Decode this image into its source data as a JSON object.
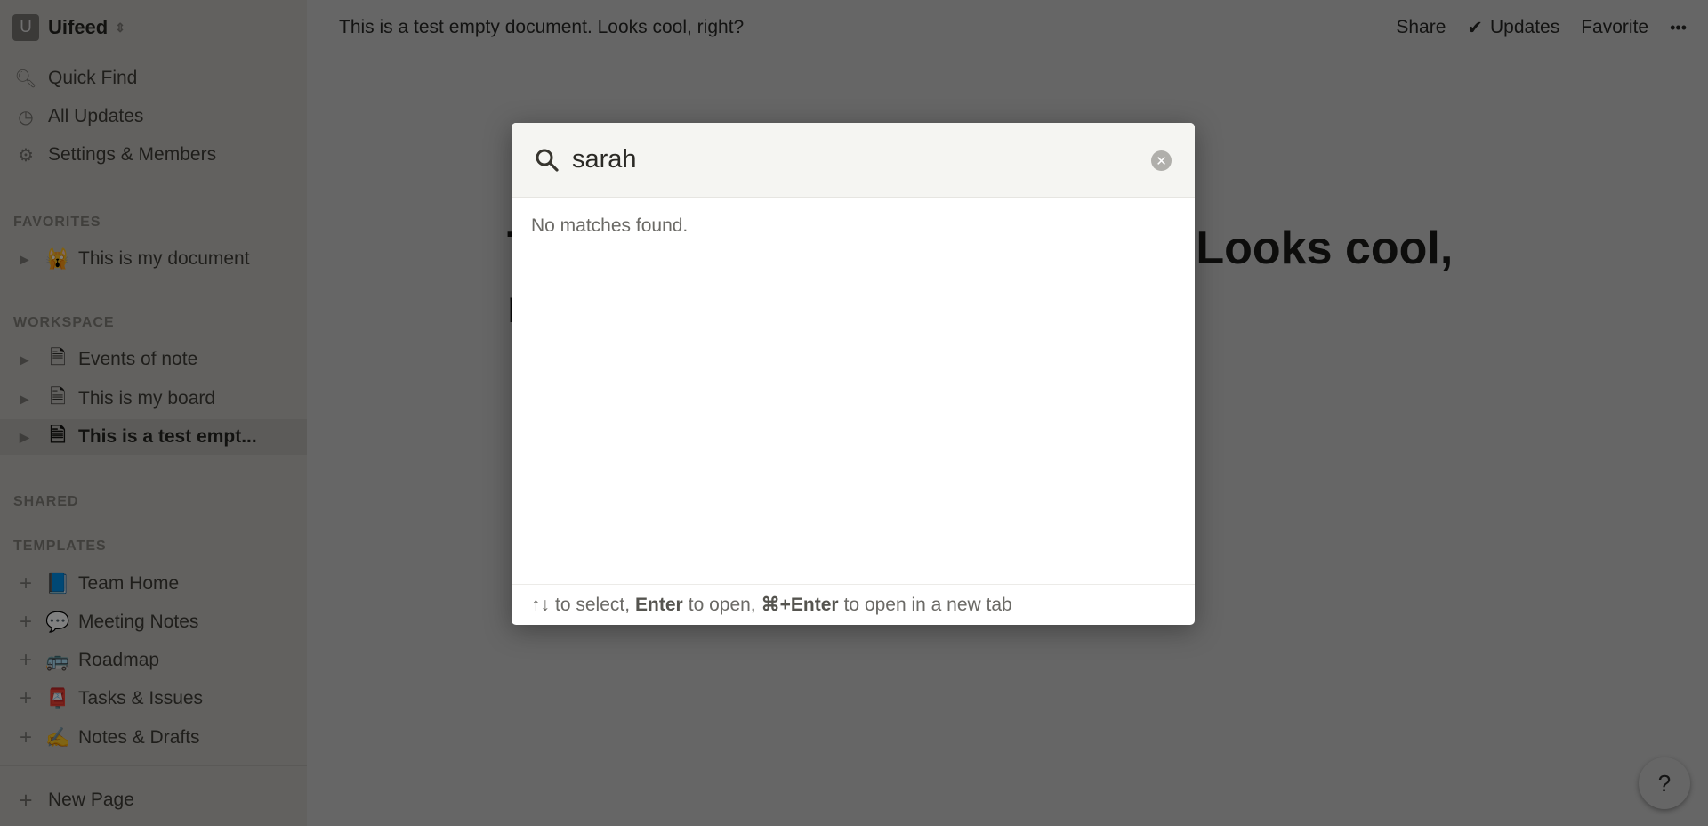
{
  "workspace": {
    "badge": "U",
    "name": "Uifeed"
  },
  "nav": [
    {
      "icon": "search-icon",
      "label": "Quick Find"
    },
    {
      "icon": "clock-icon",
      "label": "All Updates"
    },
    {
      "icon": "gear-icon",
      "label": "Settings & Members"
    }
  ],
  "sections": {
    "favorites": "FAVORITES",
    "workspace": "WORKSPACE",
    "shared": "SHARED",
    "templates": "TEMPLATES"
  },
  "favorites": [
    {
      "emoji": "🙀",
      "label": "This is my document"
    }
  ],
  "workspace_pages": [
    {
      "label": "Events of note"
    },
    {
      "label": "This is my board"
    },
    {
      "label": "This is a test empt...",
      "selected": true
    }
  ],
  "templates": [
    {
      "emoji": "📘",
      "label": "Team Home"
    },
    {
      "emoji": "💬",
      "label": "Meeting Notes"
    },
    {
      "emoji": "🚌",
      "label": "Roadmap"
    },
    {
      "emoji": "📮",
      "label": "Tasks & Issues"
    },
    {
      "emoji": "✍️",
      "label": "Notes & Drafts"
    }
  ],
  "new_page": "New Page",
  "topbar": {
    "title": "This is a test empty document. Looks cool, right?",
    "share": "Share",
    "updates": "Updates",
    "favorite": "Favorite",
    "more": "•••"
  },
  "page_title": "This is a test empty document. Looks cool, right?",
  "search": {
    "value": "sarah",
    "no_matches": "No matches found.",
    "hint": {
      "arrows": "↑↓",
      "t1": "to select,",
      "enter": "Enter",
      "t2": "to open,",
      "cmd_enter": "⌘+Enter",
      "t3": "to open in a new tab"
    }
  },
  "help": "?"
}
